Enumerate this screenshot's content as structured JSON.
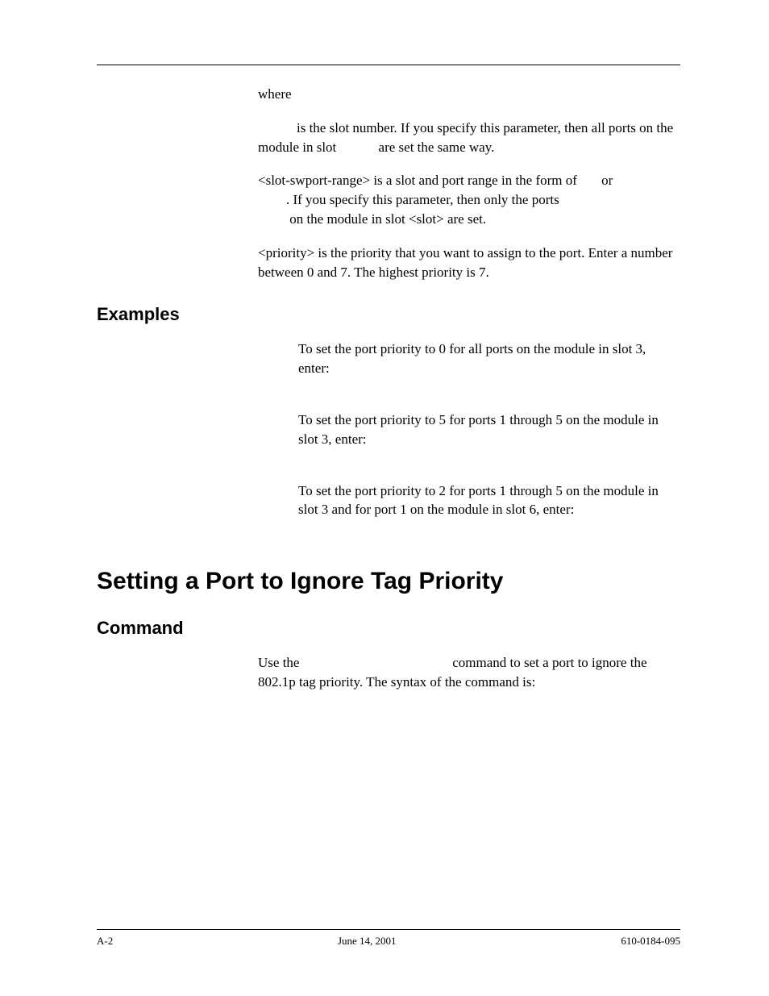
{
  "intro": {
    "where": "where",
    "slot_para_a": "is the slot number. If you specify this parameter, then all ports on the module in slot",
    "slot_para_b": "are set the same way.",
    "range_para_a": "<slot-swport-range> is a slot and port range in the form of",
    "range_para_or": "or",
    "range_para_b": ". If you specify this parameter, then only the ports",
    "range_para_c": "on the module in slot <slot> are set.",
    "priority_para": "<priority> is the priority that you want to assign to the port. Enter a number between 0 and 7. The highest priority is 7."
  },
  "headings": {
    "examples": "Examples",
    "setting": "Setting a Port to Ignore Tag Priority",
    "command": "Command"
  },
  "examples": {
    "ex1": "To set the port priority to 0 for all ports on the module in slot 3, enter:",
    "ex2": "To set the port priority to 5 for ports 1 through 5 on the module in slot 3, enter:",
    "ex3": "To set the port priority to 2 for ports 1 through 5 on the module in slot 3 and for port 1 on the module in slot 6, enter:"
  },
  "command_section": {
    "use_a": "Use the",
    "use_b": "command to set a port to ignore the 802.1p tag priority. The syntax of the command is:"
  },
  "footer": {
    "left": "A-2",
    "center": "June 14, 2001",
    "right": "610-0184-095"
  }
}
